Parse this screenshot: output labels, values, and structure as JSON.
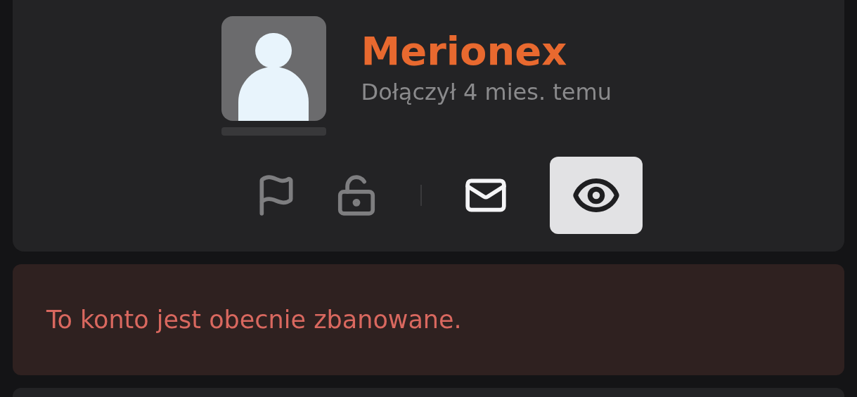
{
  "profile": {
    "name": "Merionex",
    "joined": "Dołączył 4 mies. temu"
  },
  "moderation_actions": [
    {
      "kind": "flag"
    },
    {
      "kind": "unlock"
    }
  ],
  "contact_actions": [
    {
      "kind": "mail"
    },
    {
      "kind": "eye",
      "on": true
    }
  ],
  "banner": {
    "text": "To konto jest obecnie zbanowane."
  }
}
